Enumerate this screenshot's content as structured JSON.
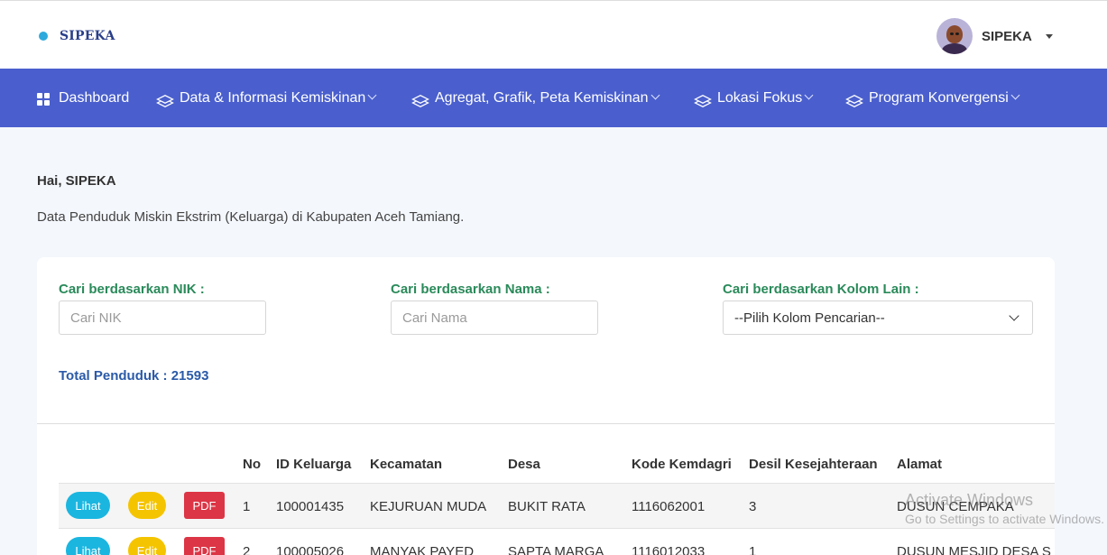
{
  "brand": {
    "name": "SIPEKA"
  },
  "user": {
    "name": "SIPEKA"
  },
  "nav": {
    "items": [
      {
        "label": "Dashboard"
      },
      {
        "label": "Data & Informasi Kemiskinan"
      },
      {
        "label": "Agregat, Grafik, Peta Kemiskinan"
      },
      {
        "label": "Lokasi Fokus"
      },
      {
        "label": "Program Konvergensi"
      }
    ]
  },
  "greeting": "Hai, SIPEKA",
  "subtitle": "Data Penduduk Miskin Ekstrim (Keluarga) di Kabupaten Aceh Tamiang.",
  "search": {
    "nik_label": "Cari berdasarkan NIK :",
    "nik_placeholder": "Cari NIK",
    "nama_label": "Cari berdasarkan Nama :",
    "nama_placeholder": "Cari Nama",
    "kolom_label": "Cari berdasarkan Kolom Lain :",
    "kolom_value": "--Pilih Kolom Pencarian--"
  },
  "total": "Total Penduduk : 21593",
  "table": {
    "headers": [
      "No",
      "ID Keluarga",
      "Kecamatan",
      "Desa",
      "Kode Kemdagri",
      "Desil Kesejahteraan",
      "Alamat"
    ],
    "actions": {
      "lihat": "Lihat",
      "edit": "Edit",
      "pdf": "PDF"
    },
    "rows": [
      [
        "1",
        "100001435",
        "KEJURUAN MUDA",
        "BUKIT RATA",
        "1116062001",
        "3",
        "DUSUN CEMPAKA"
      ],
      [
        "2",
        "100005026",
        "MANYAK PAYED",
        "SAPTA MARGA",
        "1116012033",
        "1",
        "DUSUN MESJID DESA S"
      ]
    ]
  },
  "watermark": {
    "line1": "Activate Windows",
    "line2": "Go to Settings to activate Windows."
  },
  "colors": {
    "navbar": "#4a5fcd",
    "label_green": "#2a8a5a",
    "total_blue": "#2a5aa8",
    "btn_lihat": "#1ab6e0",
    "btn_edit": "#f5c400",
    "btn_pdf": "#dc3545"
  }
}
